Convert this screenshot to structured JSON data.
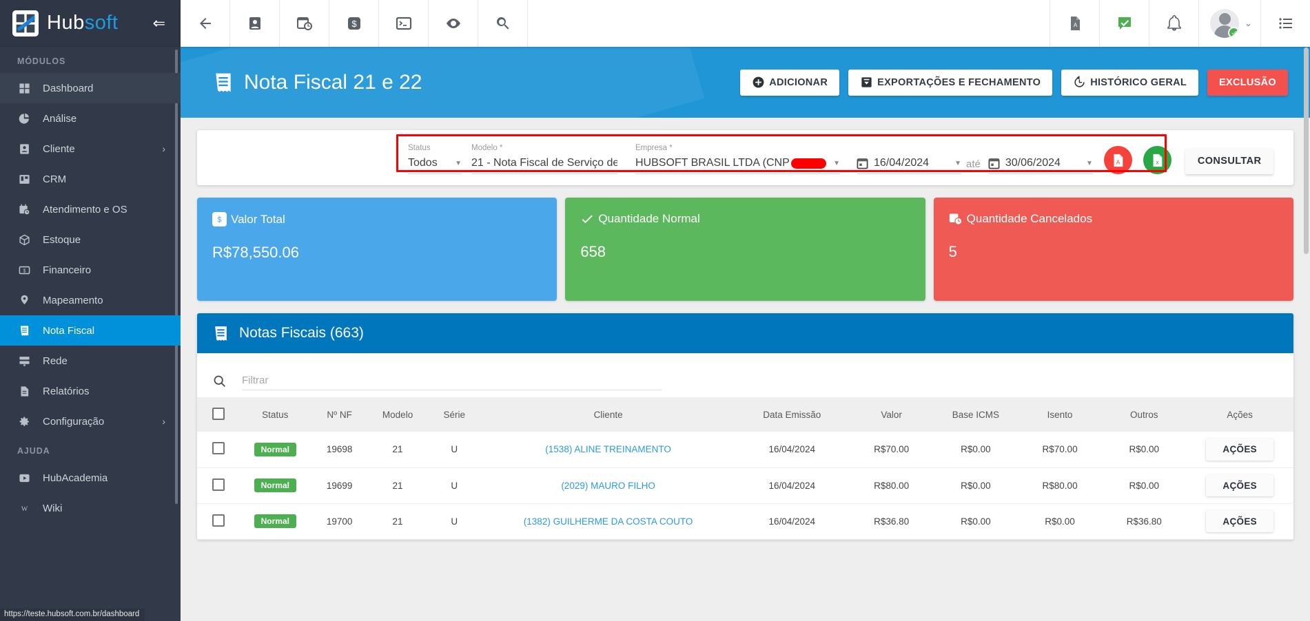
{
  "brand": {
    "word1": "Hub",
    "word2": "soft",
    "collapse_icon": "⇐"
  },
  "sidebar": {
    "section_modulos": "MÓDULOS",
    "section_ajuda": "AJUDA",
    "items": [
      {
        "label": "Dashboard",
        "icon": "grid-icon",
        "state": "hover"
      },
      {
        "label": "Análise",
        "icon": "pie-chart-icon",
        "state": ""
      },
      {
        "label": "Cliente",
        "icon": "user-card-icon",
        "state": "",
        "chevron": "›"
      },
      {
        "label": "CRM",
        "icon": "board-icon",
        "state": ""
      },
      {
        "label": "Atendimento e OS",
        "icon": "calendar-clock-icon",
        "state": ""
      },
      {
        "label": "Estoque",
        "icon": "box-icon",
        "state": ""
      },
      {
        "label": "Financeiro",
        "icon": "money-icon",
        "state": ""
      },
      {
        "label": "Mapeamento",
        "icon": "map-pin-icon",
        "state": ""
      },
      {
        "label": "Nota Fiscal",
        "icon": "receipt-icon",
        "state": "active"
      },
      {
        "label": "Rede",
        "icon": "server-icon",
        "state": ""
      },
      {
        "label": "Relatórios",
        "icon": "document-icon",
        "state": ""
      },
      {
        "label": "Configuração",
        "icon": "gear-icon",
        "state": "",
        "chevron": "›"
      }
    ],
    "help_items": [
      {
        "label": "HubAcademia",
        "icon": "play-video-icon"
      },
      {
        "label": "Wiki",
        "icon": "wiki-icon"
      }
    ]
  },
  "statusbar": {
    "url": "https://teste.hubsoft.com.br/dashboard"
  },
  "topbar": {
    "left_icons": [
      "back-arrow-icon",
      "contact-icon",
      "calendar-clock-icon",
      "dollar-icon",
      "terminal-icon",
      "eye-icon",
      "search-icon"
    ],
    "right_icons": [
      "pdf-icon",
      "check-message-icon",
      "bell-icon"
    ],
    "menu_icon": "list-menu-icon",
    "avatar_caret": "⌄"
  },
  "page": {
    "title": "Nota Fiscal 21 e 22",
    "title_icon": "receipt-icon",
    "actions": [
      {
        "label": "ADICIONAR",
        "icon": "plus-circle-icon",
        "style": "light"
      },
      {
        "label": "EXPORTAÇÕES E FECHAMENTO",
        "icon": "archive-down-icon",
        "style": "light"
      },
      {
        "label": "HISTÓRICO GERAL",
        "icon": "history-clock-icon",
        "style": "light"
      },
      {
        "label": "EXCLUSÃO",
        "icon": "",
        "style": "danger"
      }
    ],
    "header_bg": "#2196d6"
  },
  "filters": {
    "status": {
      "label": "Status",
      "value": "Todos"
    },
    "modelo": {
      "label": "Modelo *",
      "value": "21 - Nota Fiscal de Serviço de ..."
    },
    "empresa": {
      "label": "Empresa *",
      "value": "HUBSOFT BRASIL LTDA (CNP",
      "redacted": true
    },
    "date_from": {
      "value": "16/04/2024",
      "icon": "calendar-icon"
    },
    "date_sep": "até",
    "date_to": {
      "value": "30/06/2024",
      "icon": "calendar-icon"
    },
    "pdf_button": {
      "name": "export-pdf-button",
      "color": "#f4433a",
      "icon": "pdf-file-icon"
    },
    "excel_button": {
      "name": "export-excel-button",
      "color": "#28a745",
      "icon": "excel-file-icon"
    },
    "submit": "CONSULTAR",
    "highlight_color": "#ff0000"
  },
  "stats": [
    {
      "label": "Valor Total",
      "value": "R$78,550.06",
      "color": "#4aa7ea",
      "icon": "dollar-icon"
    },
    {
      "label": "Quantidade Normal",
      "value": "658",
      "color": "#5cb85c",
      "icon": "check-icon"
    },
    {
      "label": "Quantidade Cancelados",
      "value": "5",
      "color": "#ef5b54",
      "icon": "calendar-clock-icon"
    }
  ],
  "table": {
    "title": "Notas Fiscais (663)",
    "title_icon": "receipt-icon",
    "search_placeholder": "Filtrar",
    "search_value": "",
    "columns": [
      "",
      "Status",
      "Nº NF",
      "Modelo",
      "Série",
      "Cliente",
      "Data Emissão",
      "Valor",
      "Base ICMS",
      "Isento",
      "Outros",
      "Ações"
    ],
    "rows": [
      {
        "status": "Normal",
        "nf": "19698",
        "modelo": "21",
        "serie": "U",
        "cliente": "(1538) ALINE TREINAMENTO",
        "data": "16/04/2024",
        "valor": "R$70.00",
        "base_icms": "R$0.00",
        "isento": "R$70.00",
        "outros": "R$0.00",
        "acoes": "AÇÕES"
      },
      {
        "status": "Normal",
        "nf": "19699",
        "modelo": "21",
        "serie": "U",
        "cliente": "(2029) MAURO FILHO",
        "data": "16/04/2024",
        "valor": "R$80.00",
        "base_icms": "R$0.00",
        "isento": "R$80.00",
        "outros": "R$0.00",
        "acoes": "AÇÕES"
      },
      {
        "status": "Normal",
        "nf": "19700",
        "modelo": "21",
        "serie": "U",
        "cliente": "(1382) GUILHERME DA COSTA COUTO",
        "data": "16/04/2024",
        "valor": "R$36.80",
        "base_icms": "R$0.00",
        "isento": "R$0.00",
        "outros": "R$36.80",
        "acoes": "AÇÕES"
      }
    ]
  }
}
